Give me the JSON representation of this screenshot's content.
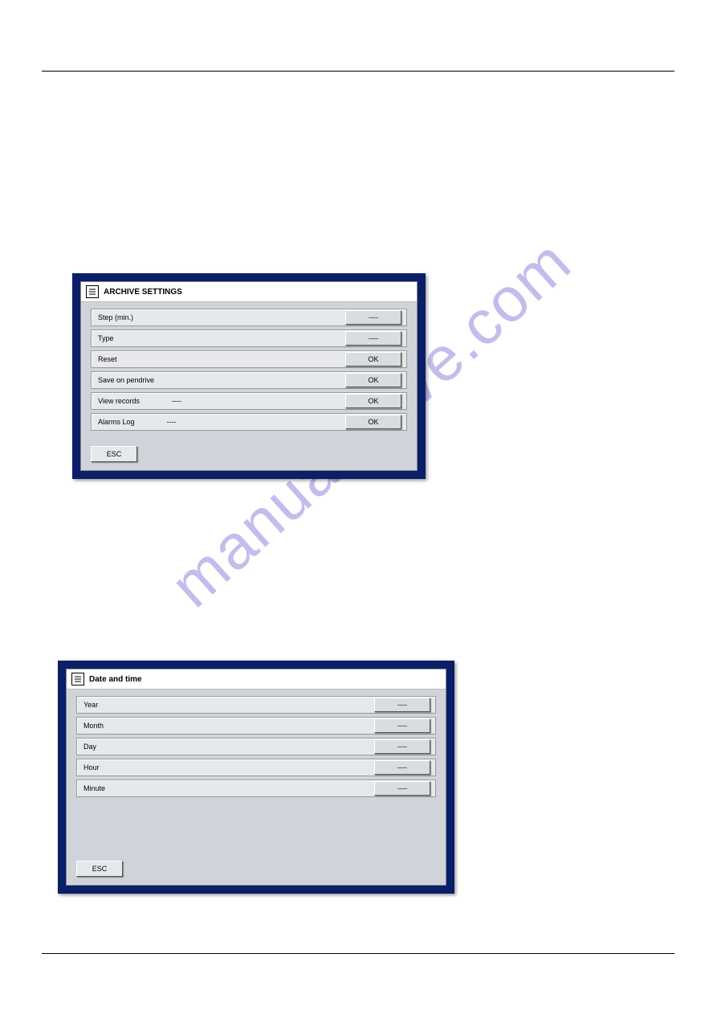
{
  "watermark": "manualshive.com",
  "panel1": {
    "title": "ARCHIVE SETTINGS",
    "rows": [
      {
        "label": "Step (min.)",
        "extra": "",
        "button": "----"
      },
      {
        "label": "Type",
        "extra": "",
        "button": "----"
      },
      {
        "label": "Reset",
        "extra": "",
        "button": "OK"
      },
      {
        "label": "Save on pendrive",
        "extra": "",
        "button": "OK"
      },
      {
        "label": "View records",
        "extra": "----",
        "button": "OK"
      },
      {
        "label": "Alarms Log",
        "extra": "----",
        "button": "OK"
      }
    ],
    "esc": "ESC"
  },
  "panel2": {
    "title": "Date and time",
    "rows": [
      {
        "label": "Year",
        "extra": "",
        "button": "----"
      },
      {
        "label": "Month",
        "extra": "",
        "button": "----"
      },
      {
        "label": "Day",
        "extra": "",
        "button": "----"
      },
      {
        "label": "Hour",
        "extra": "",
        "button": "----"
      },
      {
        "label": "Minute",
        "extra": "",
        "button": "----"
      }
    ],
    "esc": "ESC"
  }
}
